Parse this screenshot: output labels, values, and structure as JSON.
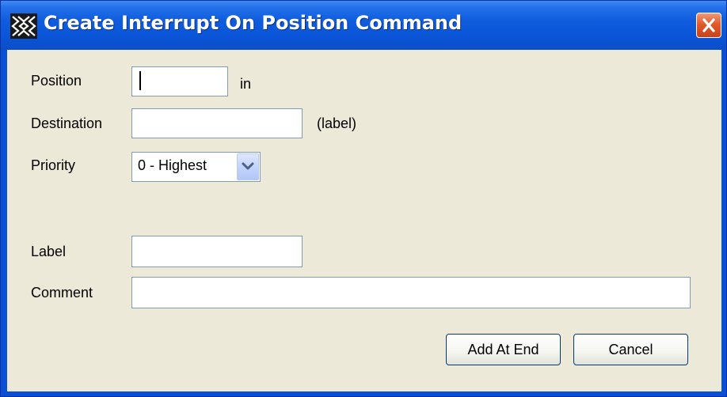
{
  "window": {
    "title": "Create Interrupt On Position Command"
  },
  "colors": {
    "titlebar": "#0a55d8",
    "client_background": "#ece9d8",
    "field_border": "#7f9db9",
    "close_button": "#e15a2a"
  },
  "form": {
    "position": {
      "label": "Position",
      "value": "",
      "unit": "in"
    },
    "destination": {
      "label": "Destination",
      "value": "",
      "hint": "(label)"
    },
    "priority": {
      "label": "Priority",
      "selected": "0 - Highest"
    },
    "label_field": {
      "label": "Label",
      "value": ""
    },
    "comment": {
      "label": "Comment",
      "value": ""
    }
  },
  "buttons": {
    "add_at_end": "Add At End",
    "cancel": "Cancel"
  },
  "icons": {
    "app": "app-icon",
    "close": "close-icon",
    "dropdown": "chevron-down-icon"
  }
}
